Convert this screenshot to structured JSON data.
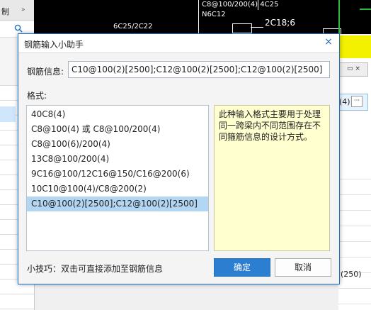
{
  "background": {
    "left_menu_label": "制",
    "left_menu_arrow": "»",
    "cad_texts": [
      "6C25/2C22",
      "C8@100/200(4) 4C25",
      "N6C12",
      "2C18;6"
    ],
    "right_cell_value": "(4)",
    "right_cell_button": "···",
    "right_bottom_value": "(250)"
  },
  "dialog": {
    "title": "钢筋输入小助手",
    "close_symbol": "×",
    "info_label": "钢筋信息:",
    "info_value": "C10@100(2)[2500];C12@100(2)[2500];C12@100(2)[2500]",
    "format_label": "格式:",
    "format_items": [
      "40C8(4)",
      "C8@100(4) 或 C8@100/200(4)",
      "C8@100(6)/200(4)",
      "13C8@100/200(4)",
      "9C16@100/12C16@150/C16@200(6)",
      "10C10@100(4)/C8@200(2)",
      "C10@100(2)[2500];C12@100(2)[2500]"
    ],
    "selected_index": 6,
    "description": "此种输入格式主要用于处理同一跨梁内不同范围存在不同箍筋信息的设计方式。",
    "tip": "小技巧：双击可直接添加至钢筋信息",
    "ok_label": "确定",
    "cancel_label": "取消"
  },
  "colors": {
    "accent": "#2b7ed0",
    "selection": "#b3d7f3",
    "description_bg": "#ffffcf",
    "cad_background": "#000000",
    "cad_highlight": "#f3f000"
  }
}
